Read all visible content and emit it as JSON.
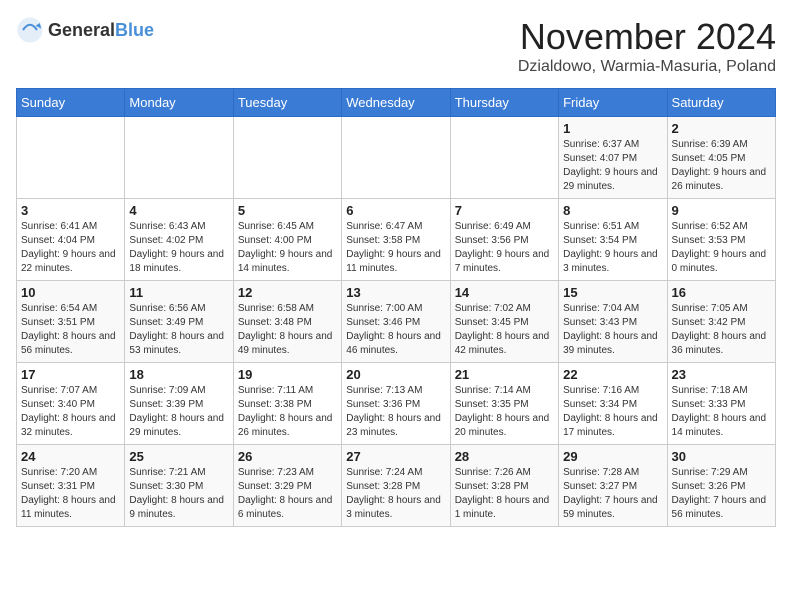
{
  "header": {
    "logo_general": "General",
    "logo_blue": "Blue",
    "month_title": "November 2024",
    "location": "Dzialdowo, Warmia-Masuria, Poland"
  },
  "weekdays": [
    "Sunday",
    "Monday",
    "Tuesday",
    "Wednesday",
    "Thursday",
    "Friday",
    "Saturday"
  ],
  "weeks": [
    [
      {
        "day": "",
        "info": ""
      },
      {
        "day": "",
        "info": ""
      },
      {
        "day": "",
        "info": ""
      },
      {
        "day": "",
        "info": ""
      },
      {
        "day": "",
        "info": ""
      },
      {
        "day": "1",
        "info": "Sunrise: 6:37 AM\nSunset: 4:07 PM\nDaylight: 9 hours and 29 minutes."
      },
      {
        "day": "2",
        "info": "Sunrise: 6:39 AM\nSunset: 4:05 PM\nDaylight: 9 hours and 26 minutes."
      }
    ],
    [
      {
        "day": "3",
        "info": "Sunrise: 6:41 AM\nSunset: 4:04 PM\nDaylight: 9 hours and 22 minutes."
      },
      {
        "day": "4",
        "info": "Sunrise: 6:43 AM\nSunset: 4:02 PM\nDaylight: 9 hours and 18 minutes."
      },
      {
        "day": "5",
        "info": "Sunrise: 6:45 AM\nSunset: 4:00 PM\nDaylight: 9 hours and 14 minutes."
      },
      {
        "day": "6",
        "info": "Sunrise: 6:47 AM\nSunset: 3:58 PM\nDaylight: 9 hours and 11 minutes."
      },
      {
        "day": "7",
        "info": "Sunrise: 6:49 AM\nSunset: 3:56 PM\nDaylight: 9 hours and 7 minutes."
      },
      {
        "day": "8",
        "info": "Sunrise: 6:51 AM\nSunset: 3:54 PM\nDaylight: 9 hours and 3 minutes."
      },
      {
        "day": "9",
        "info": "Sunrise: 6:52 AM\nSunset: 3:53 PM\nDaylight: 9 hours and 0 minutes."
      }
    ],
    [
      {
        "day": "10",
        "info": "Sunrise: 6:54 AM\nSunset: 3:51 PM\nDaylight: 8 hours and 56 minutes."
      },
      {
        "day": "11",
        "info": "Sunrise: 6:56 AM\nSunset: 3:49 PM\nDaylight: 8 hours and 53 minutes."
      },
      {
        "day": "12",
        "info": "Sunrise: 6:58 AM\nSunset: 3:48 PM\nDaylight: 8 hours and 49 minutes."
      },
      {
        "day": "13",
        "info": "Sunrise: 7:00 AM\nSunset: 3:46 PM\nDaylight: 8 hours and 46 minutes."
      },
      {
        "day": "14",
        "info": "Sunrise: 7:02 AM\nSunset: 3:45 PM\nDaylight: 8 hours and 42 minutes."
      },
      {
        "day": "15",
        "info": "Sunrise: 7:04 AM\nSunset: 3:43 PM\nDaylight: 8 hours and 39 minutes."
      },
      {
        "day": "16",
        "info": "Sunrise: 7:05 AM\nSunset: 3:42 PM\nDaylight: 8 hours and 36 minutes."
      }
    ],
    [
      {
        "day": "17",
        "info": "Sunrise: 7:07 AM\nSunset: 3:40 PM\nDaylight: 8 hours and 32 minutes."
      },
      {
        "day": "18",
        "info": "Sunrise: 7:09 AM\nSunset: 3:39 PM\nDaylight: 8 hours and 29 minutes."
      },
      {
        "day": "19",
        "info": "Sunrise: 7:11 AM\nSunset: 3:38 PM\nDaylight: 8 hours and 26 minutes."
      },
      {
        "day": "20",
        "info": "Sunrise: 7:13 AM\nSunset: 3:36 PM\nDaylight: 8 hours and 23 minutes."
      },
      {
        "day": "21",
        "info": "Sunrise: 7:14 AM\nSunset: 3:35 PM\nDaylight: 8 hours and 20 minutes."
      },
      {
        "day": "22",
        "info": "Sunrise: 7:16 AM\nSunset: 3:34 PM\nDaylight: 8 hours and 17 minutes."
      },
      {
        "day": "23",
        "info": "Sunrise: 7:18 AM\nSunset: 3:33 PM\nDaylight: 8 hours and 14 minutes."
      }
    ],
    [
      {
        "day": "24",
        "info": "Sunrise: 7:20 AM\nSunset: 3:31 PM\nDaylight: 8 hours and 11 minutes."
      },
      {
        "day": "25",
        "info": "Sunrise: 7:21 AM\nSunset: 3:30 PM\nDaylight: 8 hours and 9 minutes."
      },
      {
        "day": "26",
        "info": "Sunrise: 7:23 AM\nSunset: 3:29 PM\nDaylight: 8 hours and 6 minutes."
      },
      {
        "day": "27",
        "info": "Sunrise: 7:24 AM\nSunset: 3:28 PM\nDaylight: 8 hours and 3 minutes."
      },
      {
        "day": "28",
        "info": "Sunrise: 7:26 AM\nSunset: 3:28 PM\nDaylight: 8 hours and 1 minute."
      },
      {
        "day": "29",
        "info": "Sunrise: 7:28 AM\nSunset: 3:27 PM\nDaylight: 7 hours and 59 minutes."
      },
      {
        "day": "30",
        "info": "Sunrise: 7:29 AM\nSunset: 3:26 PM\nDaylight: 7 hours and 56 minutes."
      }
    ]
  ]
}
